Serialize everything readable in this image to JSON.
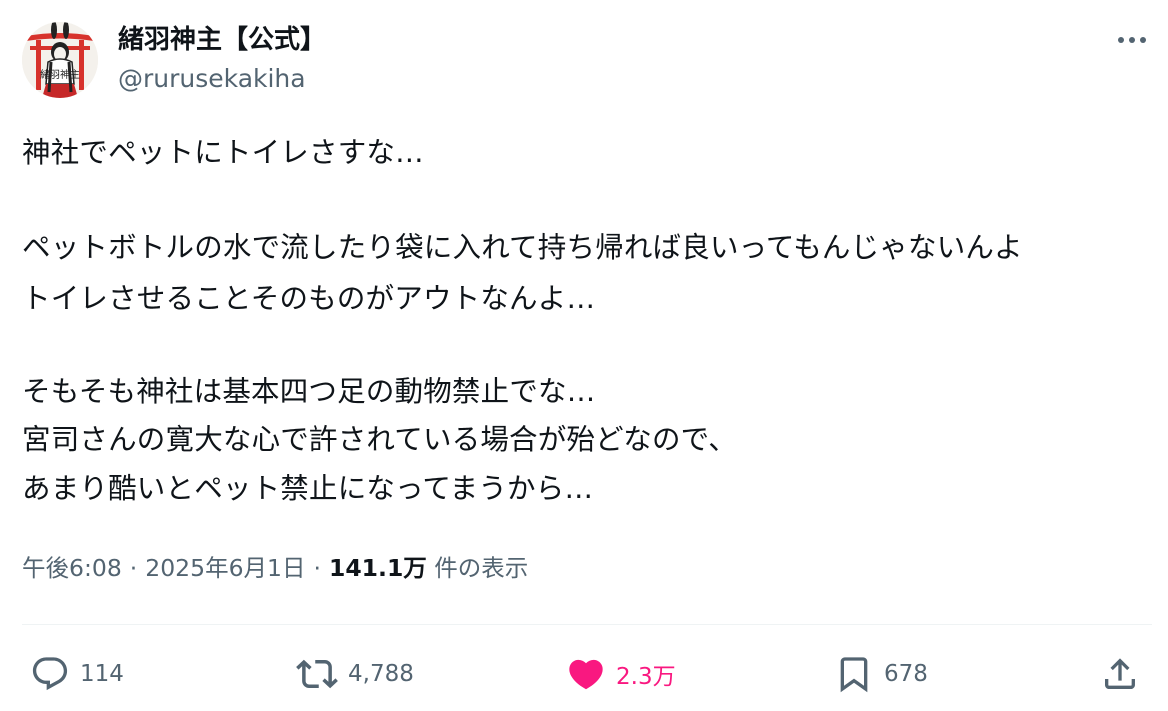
{
  "author": {
    "display_name": "緒羽神主【公式】",
    "handle": "@rurusekakiha",
    "avatar_caption": "緒羽神主"
  },
  "tweet": {
    "lines": [
      "神社でペットにトイレさすな…",
      "ペットボトルの水で流したり袋に入れて持ち帰れば良いってもんじゃないんよ",
      "トイレさせることそのものがアウトなんよ…",
      "そもそも神社は基本四つ足の動物禁止でな…",
      "宮司さんの寛大な心で許されている場合が殆どなので、",
      "あまり酷いとペット禁止になってまうから…"
    ]
  },
  "meta": {
    "time": "午後6:08",
    "separator": "·",
    "date": "2025年6月1日",
    "views_count": "141.1万",
    "views_label": "件の表示"
  },
  "actions": {
    "reply_count": "114",
    "retweet_count": "4,788",
    "like_count": "2.3万",
    "bookmark_count": "678"
  },
  "colors": {
    "text": "#0f1419",
    "secondary": "#536471",
    "like": "#f91880",
    "torii": "#d7322c"
  }
}
